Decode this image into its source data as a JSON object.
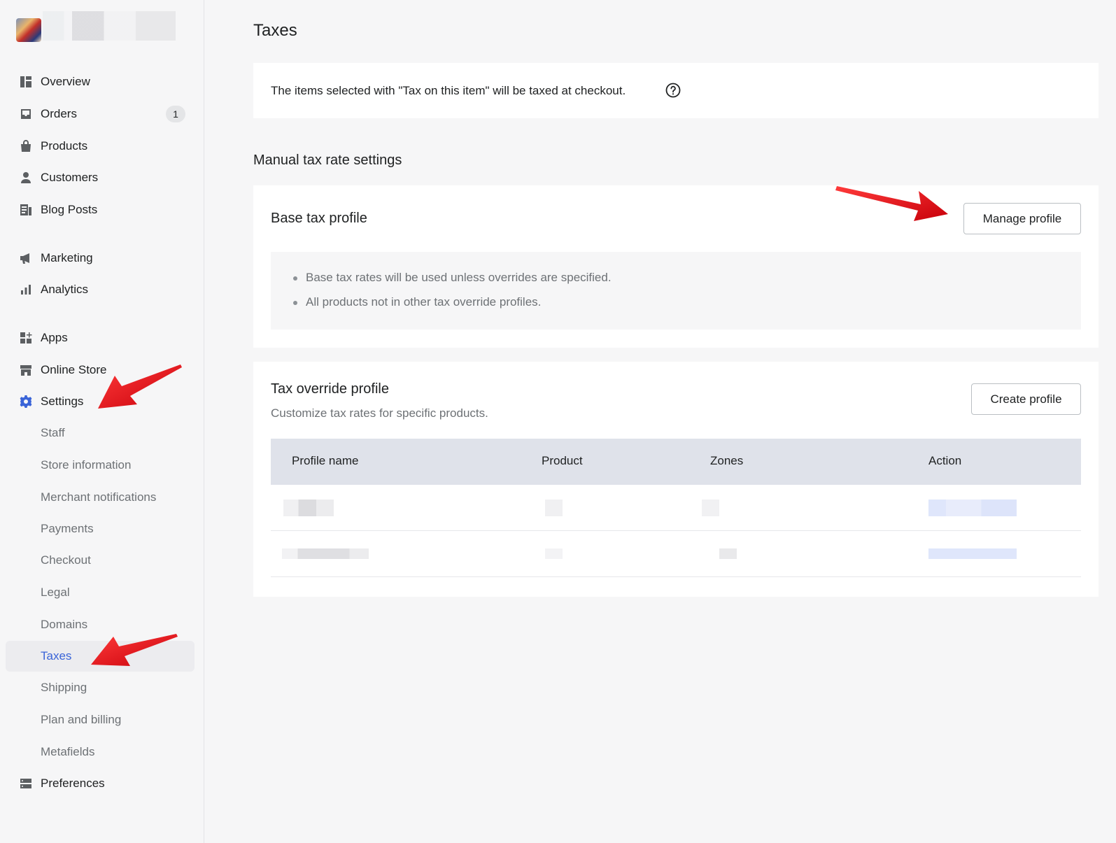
{
  "sidebar": {
    "items": [
      {
        "label": "Overview",
        "icon": "overview-icon"
      },
      {
        "label": "Orders",
        "icon": "inbox-icon",
        "badge": "1"
      },
      {
        "label": "Products",
        "icon": "bag-icon"
      },
      {
        "label": "Customers",
        "icon": "person-icon"
      },
      {
        "label": "Blog Posts",
        "icon": "blog-icon"
      },
      {
        "label": "Marketing",
        "icon": "megaphone-icon"
      },
      {
        "label": "Analytics",
        "icon": "bar-chart-icon"
      },
      {
        "label": "Apps",
        "icon": "apps-icon"
      },
      {
        "label": "Online Store",
        "icon": "store-icon"
      },
      {
        "label": "Settings",
        "icon": "gear-icon"
      },
      {
        "label": "Preferences",
        "icon": "preferences-icon"
      }
    ],
    "settings_sub": [
      "Staff",
      "Store information",
      "Merchant notifications",
      "Payments",
      "Checkout",
      "Legal",
      "Domains",
      "Taxes",
      "Shipping",
      "Plan and billing",
      "Metafields"
    ],
    "active_item": "Taxes"
  },
  "main": {
    "title": "Taxes",
    "info_text": "The items selected with \"Tax on this item\" will be taxed at checkout.",
    "manual_section_title": "Manual tax rate settings",
    "base_profile": {
      "title": "Base tax profile",
      "button": "Manage profile",
      "bullets": [
        "Base tax rates will be used unless overrides are specified.",
        "All products not in other tax override profiles."
      ]
    },
    "override_profile": {
      "title": "Tax override profile",
      "subtitle": "Customize tax rates for specific products.",
      "button": "Create profile",
      "columns": [
        "Profile name",
        "Product",
        "Zones",
        "Action"
      ]
    }
  },
  "colors": {
    "accent": "#3a64d8",
    "annotation_arrow": "#e3131b",
    "table_header": "#dfe2ea"
  }
}
